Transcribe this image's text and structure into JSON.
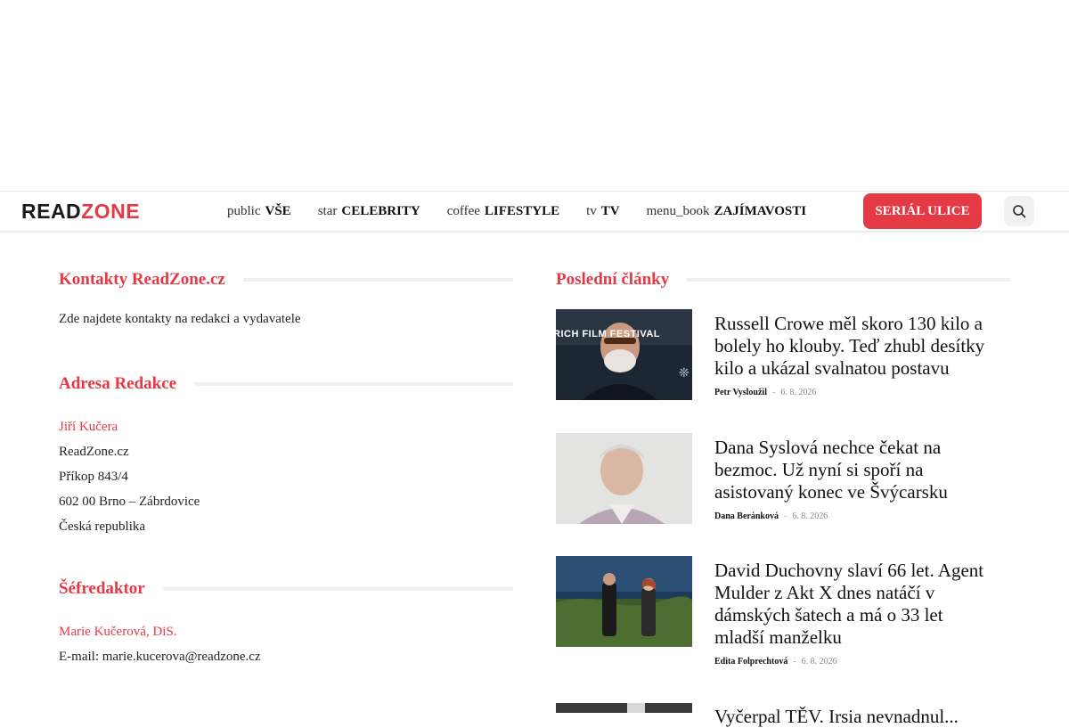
{
  "logo": {
    "part1": "READ",
    "part2": "ZONE"
  },
  "nav": {
    "items": [
      {
        "icon": "public",
        "label": "VŠE"
      },
      {
        "icon": "star",
        "label": "CELEBRITY"
      },
      {
        "icon": "coffee",
        "label": "LIFESTYLE"
      },
      {
        "icon": "tv",
        "label": "TV"
      },
      {
        "icon": "menu_book",
        "label": "ZAJÍMAVOSTI"
      }
    ],
    "cta": "SERIÁL ULICE",
    "search_icon": "search-icon"
  },
  "contacts": {
    "title": "Kontakty ReadZone.cz",
    "intro": "Zde najdete kontakty na redakci a vydavatele",
    "address_title": "Adresa Redakce",
    "address_name": "Jiří Kučera",
    "address_lines": [
      "ReadZone.cz",
      "Příkop 843/4",
      "602 00 Brno – Zábrdovice",
      "Česká republika"
    ],
    "editor_title": "Šéfredaktor",
    "editor_name": "Marie Kučerová, DiS.",
    "editor_email": "E-mail: marie.kucerova@readzone.cz"
  },
  "latest": {
    "title": "Poslední články",
    "articles": [
      {
        "title": "Russell Crowe měl skoro 130 kilo a bolely ho klouby. Teď zhubl desítky kilo a ukázal svalnatou postavu",
        "author": "Petr Vysloužil",
        "date": "6. 8. 2026",
        "thumb_text": "RICH FILM FESTIVAL"
      },
      {
        "title": "Dana Syslová nechce čekat na bezmoc. Už nyní si spoří na asistovaný konec ve Švýcarsku",
        "author": "Dana Beránková",
        "date": "6. 8. 2026"
      },
      {
        "title": "David Duchovny slaví 66 let. Agent Mulder z Akt X dnes natáčí v dámských šatech a má o 33 let mladší manželku",
        "author": "Edita Folprechtová",
        "date": "6. 8. 2026"
      },
      {
        "title": "Vyčerpal TĚV. Irsia nevnadnul..."
      }
    ]
  },
  "colors": {
    "accent": "#e63946"
  }
}
